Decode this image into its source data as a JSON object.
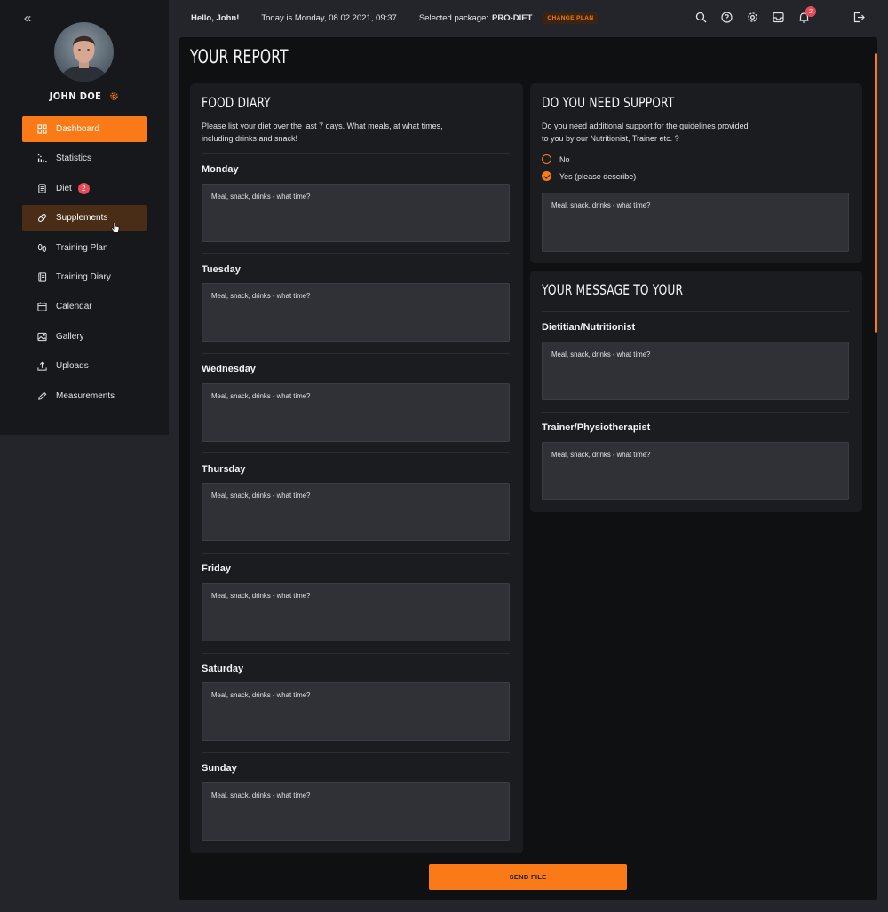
{
  "user": {
    "name": "JOHN DOE"
  },
  "sidebar": {
    "items": [
      {
        "label": "Dashboard",
        "icon": "grid-icon",
        "state": "active"
      },
      {
        "label": "Statistics",
        "icon": "chart-icon"
      },
      {
        "label": "Diet",
        "icon": "document-icon",
        "badge": "2"
      },
      {
        "label": "Supplements",
        "icon": "pill-icon",
        "state": "hover"
      },
      {
        "label": "Training Plan",
        "icon": "footprints-icon"
      },
      {
        "label": "Training Diary",
        "icon": "notebook-icon"
      },
      {
        "label": "Calendar",
        "icon": "calendar-icon"
      },
      {
        "label": "Gallery",
        "icon": "image-icon"
      },
      {
        "label": "Uploads",
        "icon": "upload-icon"
      },
      {
        "label": "Measurements",
        "icon": "pencil-icon"
      }
    ]
  },
  "topbar": {
    "greeting": "Hello, John!",
    "date_text": "Today is Monday, 08.02.2021, 09:37",
    "package_label": "Selected package:",
    "package_value": "PRO-DIET",
    "change_plan": "CHANGE PLAN",
    "notification_count": "2"
  },
  "page": {
    "title": "YOUR REPORT"
  },
  "food_diary": {
    "title": "FOOD DIARY",
    "description_1": "Please list your diet over the last 7 days. What meals, at what times,",
    "description_2": "including drinks and snack!",
    "days": [
      {
        "label": "Monday",
        "placeholder": "Meal, snack, drinks - what time?"
      },
      {
        "label": "Tuesday",
        "placeholder": "Meal, snack, drinks - what time?"
      },
      {
        "label": "Wednesday",
        "placeholder": "Meal, snack, drinks - what time?"
      },
      {
        "label": "Thursday",
        "placeholder": "Meal, snack, drinks - what time?"
      },
      {
        "label": "Friday",
        "placeholder": "Meal, snack, drinks - what time?"
      },
      {
        "label": "Saturday",
        "placeholder": "Meal, snack, drinks - what time?"
      },
      {
        "label": "Sunday",
        "placeholder": "Meal, snack, drinks - what time?"
      }
    ]
  },
  "support": {
    "title": "DO YOU NEED SUPPORT",
    "description_1": "Do you need additional support for the guidelines provided",
    "description_2": "to you by our Nutritionist, Trainer etc. ?",
    "options": [
      {
        "label": "No",
        "checked": false
      },
      {
        "label": "Yes (please describe)",
        "checked": true
      }
    ],
    "placeholder": "Meal, snack, drinks - what time?"
  },
  "message": {
    "title": "YOUR MESSAGE TO YOUR",
    "recipients": [
      {
        "label": "Dietitian/Nutritionist",
        "placeholder": "Meal, snack, drinks - what time?"
      },
      {
        "label": "Trainer/Physiotherapist",
        "placeholder": "Meal, snack, drinks - what time?"
      }
    ]
  },
  "actions": {
    "send": "SEND FILE"
  },
  "colors": {
    "accent": "#f97a16",
    "badge": "#e84a57",
    "panel": "#1b1c20",
    "input": "#303136"
  }
}
